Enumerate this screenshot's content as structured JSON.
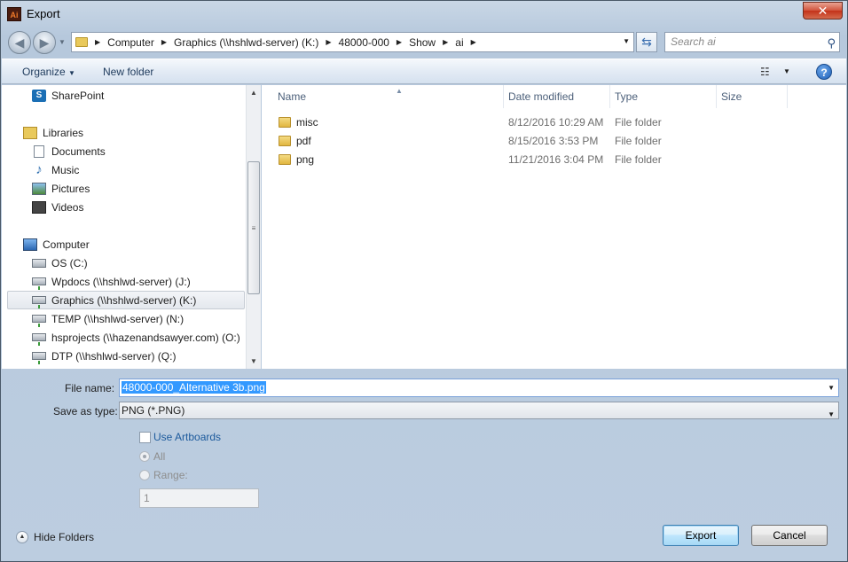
{
  "window": {
    "title": "Export",
    "app_icon": "Ai",
    "close_glyph": "✕"
  },
  "address": {
    "crumbs": [
      "Computer",
      "Graphics (\\\\hshlwd-server) (K:)",
      "48000-000",
      "Show",
      "ai"
    ],
    "search_placeholder": "Search ai"
  },
  "toolbar": {
    "organize_label": "Organize",
    "new_folder_label": "New folder",
    "help_label": "?"
  },
  "navpane": {
    "items": [
      {
        "label": "SharePoint",
        "icon": "sharepoint-icon"
      },
      {
        "label": "Libraries",
        "icon": "libraries-icon"
      },
      {
        "label": "Documents",
        "icon": "documents-icon"
      },
      {
        "label": "Music",
        "icon": "music-icon"
      },
      {
        "label": "Pictures",
        "icon": "pictures-icon"
      },
      {
        "label": "Videos",
        "icon": "videos-icon"
      },
      {
        "label": "Computer",
        "icon": "computer-icon"
      },
      {
        "label": "OS (C:)",
        "icon": "local-drive-icon"
      },
      {
        "label": "Wpdocs (\\\\hshlwd-server) (J:)",
        "icon": "network-drive-icon"
      },
      {
        "label": "Graphics (\\\\hshlwd-server) (K:)",
        "icon": "network-drive-icon",
        "selected": true
      },
      {
        "label": "TEMP (\\\\hshlwd-server) (N:)",
        "icon": "network-drive-icon"
      },
      {
        "label": "hsprojects (\\\\hazenandsawyer.com) (O:)",
        "icon": "network-drive-icon"
      },
      {
        "label": "DTP (\\\\hshlwd-server) (Q:)",
        "icon": "network-drive-icon"
      }
    ]
  },
  "filelist": {
    "columns": [
      "Name",
      "Date modified",
      "Type",
      "Size"
    ],
    "rows": [
      {
        "name": "misc",
        "date": "8/12/2016 10:29 AM",
        "type": "File folder",
        "size": ""
      },
      {
        "name": "pdf",
        "date": "8/15/2016 3:53 PM",
        "type": "File folder",
        "size": ""
      },
      {
        "name": "png",
        "date": "11/21/2016 3:04 PM",
        "type": "File folder",
        "size": ""
      }
    ]
  },
  "form": {
    "file_name_label": "File name:",
    "file_name_value": "48000-000_Alternative 3b.png",
    "save_type_label": "Save as type:",
    "save_type_value": "PNG (*.PNG)",
    "use_artboards_label": "Use Artboards",
    "all_label": "All",
    "range_label": "Range:",
    "range_value": "1"
  },
  "footer": {
    "hide_folders_label": "Hide Folders",
    "export_label": "Export",
    "cancel_label": "Cancel"
  },
  "colors": {
    "accent": "#3399ff",
    "link": "#1e3a5c"
  }
}
